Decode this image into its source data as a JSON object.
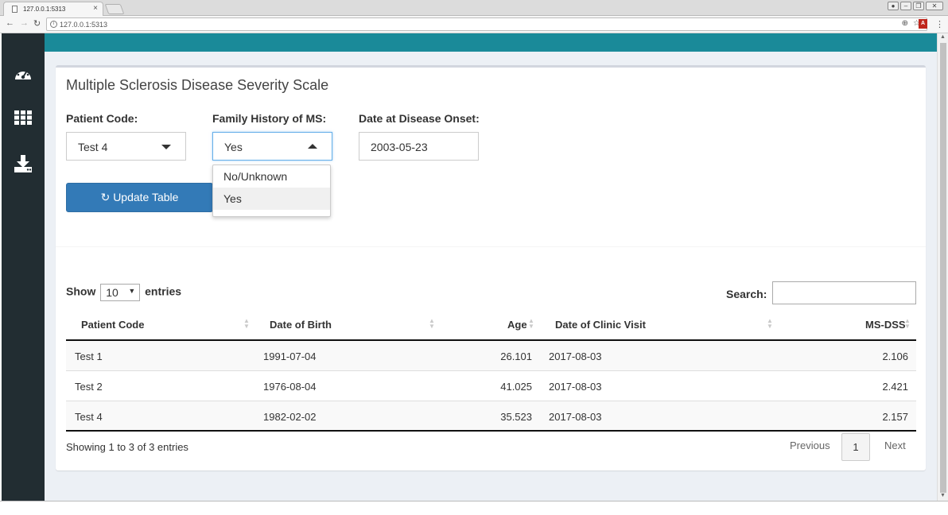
{
  "browser": {
    "tab_title": "127.0.0.1:5313",
    "tab_close": "×",
    "url": "127.0.0.1:5313"
  },
  "app": {
    "title": "Multiple Sclerosis Disease Severity Scale",
    "inputs": {
      "patient_code": {
        "label": "Patient Code:",
        "value": "Test 4"
      },
      "family_history": {
        "label": "Family History of MS:",
        "value": "Yes",
        "options": [
          "No/Unknown",
          "Yes"
        ]
      },
      "onset_date": {
        "label": "Date at Disease Onset:",
        "value": "2003-05-23"
      }
    },
    "update_button": "Update Table"
  },
  "table": {
    "show_label": "Show",
    "entries_label": "entries",
    "page_length": "10",
    "search_label": "Search:",
    "columns": [
      "Patient Code",
      "Date of Birth",
      "Age",
      "Date of Clinic Visit",
      "MS-DSS"
    ],
    "rows": [
      [
        "Test 1",
        "1991-07-04",
        "26.101",
        "2017-08-03",
        "2.106"
      ],
      [
        "Test 2",
        "1976-08-04",
        "41.025",
        "2017-08-03",
        "2.421"
      ],
      [
        "Test 4",
        "1982-02-02",
        "35.523",
        "2017-08-03",
        "2.157"
      ]
    ],
    "info": "Showing 1 to 3 of 3 entries",
    "pagination": {
      "previous": "Previous",
      "current": "1",
      "next": "Next"
    }
  },
  "colors": {
    "sidebar": "#222d32",
    "header": "#1a8a99",
    "primary": "#337ab7"
  },
  "icons": [
    "dashboard-icon",
    "grid-icon",
    "download-icon",
    "refresh-icon"
  ]
}
